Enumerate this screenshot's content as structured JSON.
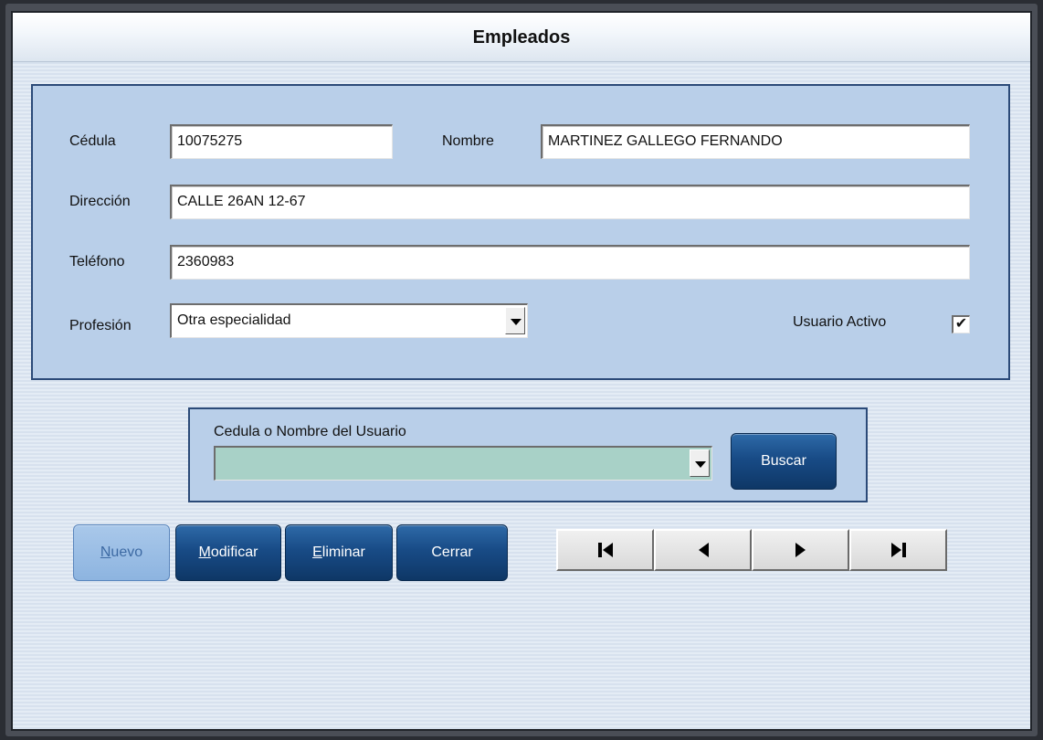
{
  "window": {
    "title": "Empleados"
  },
  "form": {
    "cedula_label": "Cédula",
    "cedula_value": "10075275",
    "nombre_label": "Nombre",
    "nombre_value": "MARTINEZ GALLEGO FERNANDO",
    "direccion_label": "Dirección",
    "direccion_value": "CALLE 26AN  12-67",
    "telefono_label": "Teléfono",
    "telefono_value": "2360983",
    "profesion_label": "Profesión",
    "profesion_value": "Otra especialidad",
    "usuario_activo_label": "Usuario Activo",
    "usuario_activo_checked": true
  },
  "search": {
    "label": "Cedula o Nombre del Usuario",
    "value": "",
    "button_label": "Buscar"
  },
  "actions": {
    "nuevo": {
      "hotkey": "N",
      "rest": "uevo",
      "enabled": false
    },
    "modificar": {
      "hotkey": "M",
      "rest": "odificar",
      "enabled": true
    },
    "eliminar": {
      "hotkey": "E",
      "rest": "liminar",
      "enabled": true
    },
    "cerrar": {
      "label": "Cerrar",
      "enabled": true
    }
  },
  "navigation": {
    "first": "first-record-icon",
    "prev": "previous-record-icon",
    "next": "next-record-icon",
    "last": "last-record-icon"
  },
  "colors": {
    "panel": "#b9cfe9",
    "button": "#184b86",
    "search_input": "#a8d1c7"
  }
}
